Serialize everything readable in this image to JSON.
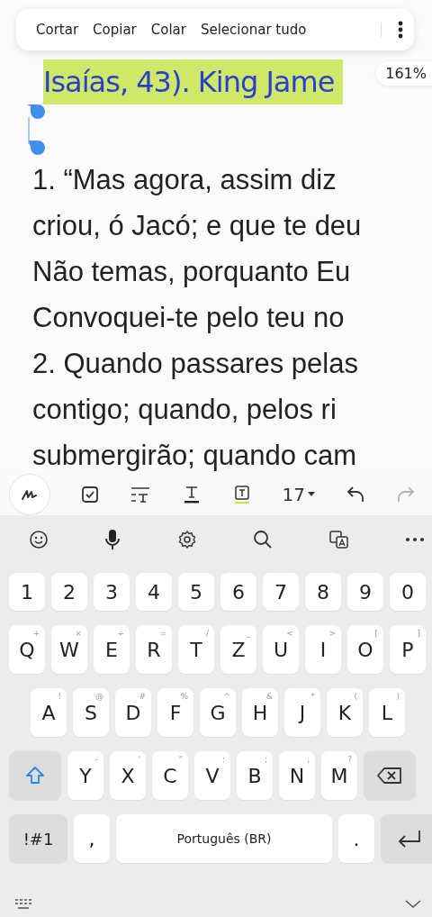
{
  "context_menu": {
    "items": [
      "Cortar",
      "Copiar",
      "Colar",
      "Selecionar tudo"
    ]
  },
  "selection": {
    "text": "Isaías, 43). King Jame"
  },
  "zoom_badge": "161%",
  "lines": [
    "1. “Mas agora, assim diz",
    "criou, ó Jacó; e que te deu",
    "Não temas, porquanto Eu",
    "Convoquei-te pelo teu no",
    "2. Quando passares pelas",
    "contigo; quando, pelos ri",
    "submergirão; quando cam"
  ],
  "format_toolbar": {
    "tools": [
      {
        "kind": "pen",
        "disabled": false
      },
      {
        "kind": "checkbox",
        "disabled": false
      },
      {
        "kind": "paragraph",
        "disabled": false
      },
      {
        "kind": "underline",
        "disabled": false
      },
      {
        "kind": "highlight",
        "disabled": false
      },
      {
        "kind": "size",
        "label": "17",
        "disabled": false
      },
      {
        "kind": "undo",
        "disabled": false
      },
      {
        "kind": "redo",
        "disabled": true
      }
    ]
  },
  "keyboard_toolbar": [
    {
      "kind": "emoji"
    },
    {
      "kind": "mic"
    },
    {
      "kind": "settings"
    },
    {
      "kind": "search"
    },
    {
      "kind": "translate"
    },
    {
      "kind": "more"
    }
  ],
  "keyboard": {
    "shift_on": true,
    "rows": [
      {
        "keys": [
          {
            "kind": "char",
            "label": "1"
          },
          {
            "kind": "char",
            "label": "2"
          },
          {
            "kind": "char",
            "label": "3"
          },
          {
            "kind": "char",
            "label": "4"
          },
          {
            "kind": "char",
            "label": "5"
          },
          {
            "kind": "char",
            "label": "6"
          },
          {
            "kind": "char",
            "label": "7"
          },
          {
            "kind": "char",
            "label": "8"
          },
          {
            "kind": "char",
            "label": "9"
          },
          {
            "kind": "char",
            "label": "0"
          }
        ]
      },
      {
        "keys": [
          {
            "kind": "char",
            "label": "Q",
            "hint": "+"
          },
          {
            "kind": "char",
            "label": "W",
            "hint": "×"
          },
          {
            "kind": "char",
            "label": "E",
            "hint": "÷"
          },
          {
            "kind": "char",
            "label": "R",
            "hint": "="
          },
          {
            "kind": "char",
            "label": "T",
            "hint": "/"
          },
          {
            "kind": "char",
            "label": "Z",
            "hint": "_"
          },
          {
            "kind": "char",
            "label": "U",
            "hint": "<"
          },
          {
            "kind": "char",
            "label": "I",
            "hint": ">"
          },
          {
            "kind": "char",
            "label": "O",
            "hint": "["
          },
          {
            "kind": "char",
            "label": "P",
            "hint": "]"
          }
        ]
      },
      {
        "keys": [
          {
            "kind": "char",
            "label": "A",
            "hint": "!"
          },
          {
            "kind": "char",
            "label": "S",
            "hint": "@"
          },
          {
            "kind": "char",
            "label": "D",
            "hint": "#"
          },
          {
            "kind": "char",
            "label": "F",
            "hint": "%"
          },
          {
            "kind": "char",
            "label": "G",
            "hint": "^"
          },
          {
            "kind": "char",
            "label": "H",
            "hint": "&"
          },
          {
            "kind": "char",
            "label": "J",
            "hint": "*"
          },
          {
            "kind": "char",
            "label": "K",
            "hint": "("
          },
          {
            "kind": "char",
            "label": "L",
            "hint": ")"
          }
        ]
      },
      {
        "keys": [
          {
            "kind": "shift"
          },
          {
            "kind": "char",
            "label": "Y",
            "hint": "-"
          },
          {
            "kind": "char",
            "label": "X",
            "hint": "'"
          },
          {
            "kind": "char",
            "label": "C",
            "hint": "\""
          },
          {
            "kind": "char",
            "label": "V",
            "hint": ":"
          },
          {
            "kind": "char",
            "label": "B",
            "hint": ";"
          },
          {
            "kind": "char",
            "label": "N",
            "hint": ","
          },
          {
            "kind": "char",
            "label": "M",
            "hint": "?"
          },
          {
            "kind": "backspace"
          }
        ]
      },
      {
        "keys": [
          {
            "kind": "symbols",
            "label": "!#1"
          },
          {
            "kind": "char",
            "label": ","
          },
          {
            "kind": "space",
            "label": "Português (BR)"
          },
          {
            "kind": "char",
            "label": "."
          },
          {
            "kind": "enter"
          }
        ]
      }
    ]
  }
}
